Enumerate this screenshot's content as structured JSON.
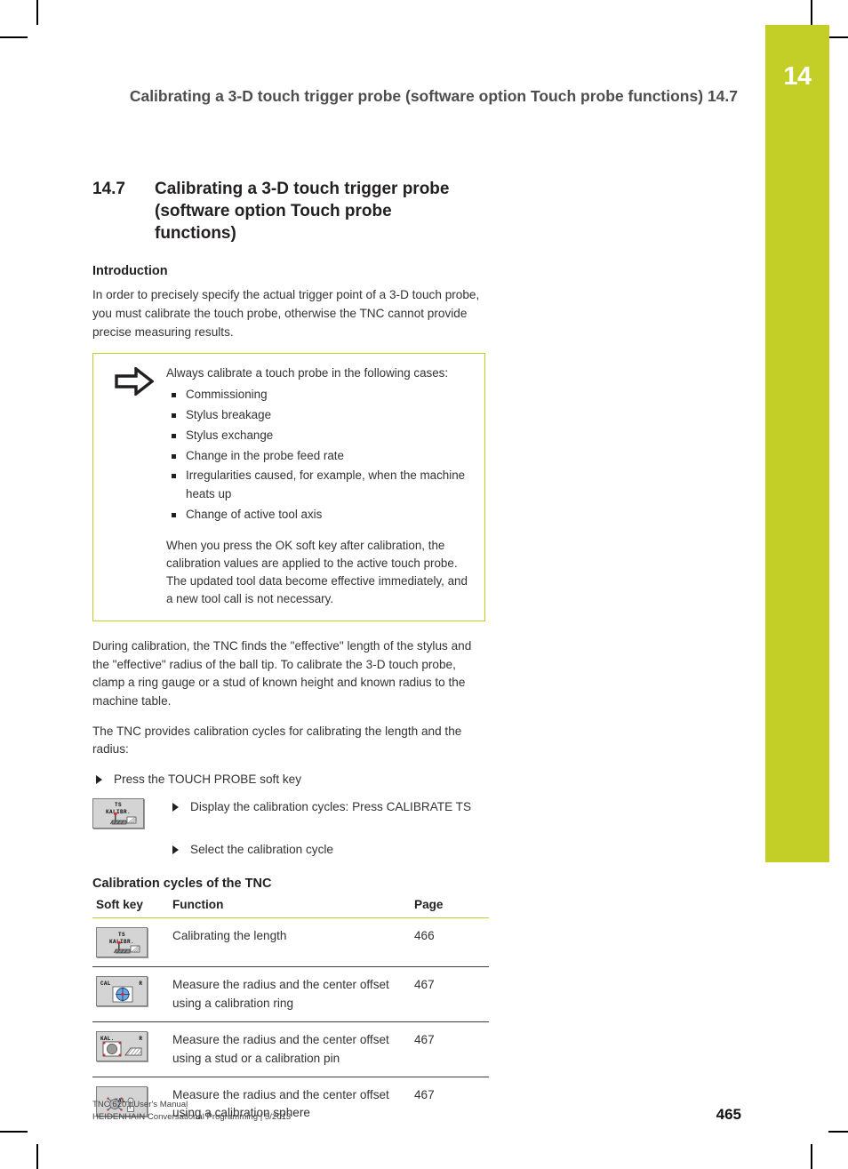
{
  "chapter_tab": {
    "number": "14",
    "color": "#c3ce26"
  },
  "running_head": {
    "title": "Calibrating a 3-D touch trigger probe (software option Touch probe functions)",
    "section": "14.7"
  },
  "section": {
    "number": "14.7",
    "title": "Calibrating a 3-D touch trigger probe (software option Touch probe functions)"
  },
  "introduction": {
    "heading": "Introduction",
    "paragraph": "In order to precisely specify the actual trigger point of a 3-D touch probe, you must calibrate the touch probe, otherwise the TNC cannot provide precise measuring results."
  },
  "note_box": {
    "icon": "right-arrow-icon",
    "border_color": "#c3ce26",
    "lead": "Always calibrate a touch probe in the following cases:",
    "items": [
      "Commissioning",
      "Stylus breakage",
      "Stylus exchange",
      "Change in the probe feed rate",
      "Irregularities caused, for example, when the machine heats up",
      "Change of active tool axis"
    ],
    "tail": "When you press the OK soft key after calibration, the calibration values are applied to the active touch probe. The updated tool data become effective immediately, and a new tool call is not necessary."
  },
  "body": {
    "paragraph1": "During calibration, the TNC finds the \"effective\" length of the stylus and the \"effective\" radius of the ball tip. To calibrate the 3-D touch probe, clamp a ring gauge or a stud of known height and known radius to the machine table.",
    "paragraph2": "The TNC provides calibration cycles for calibrating the length and the radius:"
  },
  "steps": {
    "step1": "Press the TOUCH PROBE soft key",
    "step2": "Display the calibration cycles: Press CALIBRATE TS",
    "step3": "Select the calibration cycle"
  },
  "inline_softkey": {
    "line1": "TS",
    "line2": "KALIBR.",
    "icon": "touch-probe-calibrate-length-icon"
  },
  "table": {
    "heading": "Calibration cycles of the TNC",
    "columns": {
      "softkey": "Soft key",
      "function": "Function",
      "page": "Page"
    },
    "rows": [
      {
        "softkey": {
          "line1": "TS",
          "line2": "KALIBR.",
          "icon": "calibrate-length-icon",
          "style": "stacked"
        },
        "function": "Calibrating the length",
        "page": "466"
      },
      {
        "softkey": {
          "corner_left": "CAL",
          "corner_right": "R",
          "icon": "calibration-ring-icon",
          "style": "corner"
        },
        "function": "Measure the radius and the center offset using a calibration ring",
        "page": "467"
      },
      {
        "softkey": {
          "corner_left": "KAL.",
          "corner_right": "R",
          "icon": "calibration-stud-icon",
          "style": "corner"
        },
        "function": "Measure the radius and the center offset using a stud or a calibration pin",
        "page": "467"
      },
      {
        "softkey": {
          "line1": "",
          "line2": "KAL.",
          "icon": "calibration-sphere-icon",
          "style": "stacked"
        },
        "function": "Measure the radius and the center offset using a calibration sphere",
        "page": "467"
      }
    ]
  },
  "footer": {
    "line1": "TNC 620 | User's Manual",
    "line2": "HEIDENHAIN Conversational Programming | 5/2013",
    "page_number": "465"
  }
}
